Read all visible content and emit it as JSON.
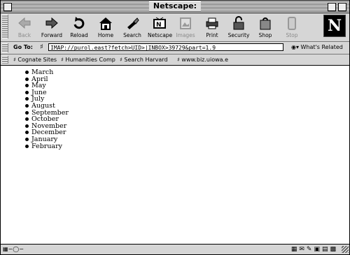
{
  "window": {
    "title": "Netscape:"
  },
  "toolbar": {
    "buttons": [
      {
        "label": "Back",
        "icon": "back-arrow-icon",
        "enabled": false
      },
      {
        "label": "Forward",
        "icon": "forward-arrow-icon",
        "enabled": true
      },
      {
        "label": "Reload",
        "icon": "reload-icon",
        "enabled": true
      },
      {
        "label": "Home",
        "icon": "home-icon",
        "enabled": true
      },
      {
        "label": "Search",
        "icon": "search-flashlight-icon",
        "enabled": true
      },
      {
        "label": "Netscape",
        "icon": "netscape-icon",
        "enabled": true
      },
      {
        "label": "Images",
        "icon": "images-icon",
        "enabled": false
      },
      {
        "label": "Print",
        "icon": "print-icon",
        "enabled": true
      },
      {
        "label": "Security",
        "icon": "security-lock-icon",
        "enabled": true
      },
      {
        "label": "Shop",
        "icon": "shop-bag-icon",
        "enabled": true
      },
      {
        "label": "Stop",
        "icon": "stop-icon",
        "enabled": false
      }
    ],
    "logo_letter": "N"
  },
  "location": {
    "label": "Go To:",
    "url": "IMAP://purol.east?fetch>UID>|INBOX>39729&part=1.9",
    "whats_related": "What's Related"
  },
  "personal_toolbar": {
    "items": [
      "Cognate Sites",
      "Humanities Comp",
      "Search Harvard",
      "www.biz.uiowa.e"
    ]
  },
  "content": {
    "months": [
      "March",
      "April",
      "May",
      "June",
      "July",
      "August",
      "September",
      "October",
      "November",
      "December",
      "January",
      "February"
    ]
  },
  "statusbar": {
    "text": ""
  }
}
